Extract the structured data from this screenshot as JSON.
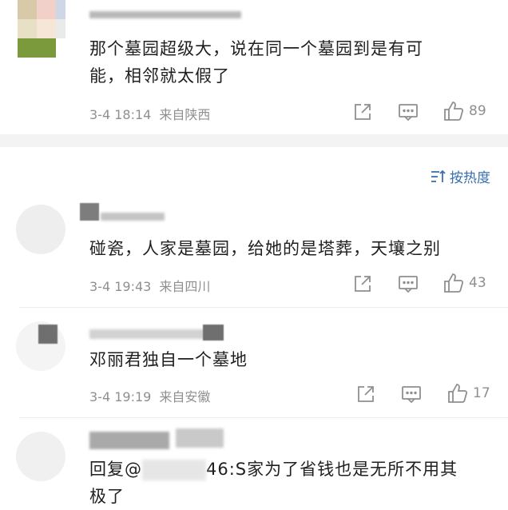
{
  "comments": [
    {
      "text_lines": [
        "那个墓园超级大，说在同一个墓园到是有可",
        "能，相邻就太假了"
      ],
      "date": "3-4 18:14",
      "location": "来自陕西",
      "likes": "89"
    },
    {
      "text_lines": [
        "碰瓷，人家是墓园，给她的是塔葬，天壤之别"
      ],
      "date": "3-4 19:43",
      "location": "来自四川",
      "likes": "43"
    },
    {
      "text_lines": [
        "邓丽君独自一个墓地"
      ],
      "date": "3-4 19:19",
      "location": "来自安徽",
      "likes": "17"
    },
    {
      "text_lines": [
        "回复@",
        "46:S家为了省钱也是无所不用其",
        "极了"
      ]
    }
  ],
  "sort": {
    "label": "按热度",
    "icon": "sort-icon"
  },
  "icons": {
    "share": "share-icon",
    "comment": "comment-icon",
    "like": "thumbs-up-icon"
  },
  "colors": {
    "accent": "#3a6fb0",
    "meta": "#8f8f8f",
    "text": "#1f1f1f",
    "separator": "#f3f3f3"
  }
}
